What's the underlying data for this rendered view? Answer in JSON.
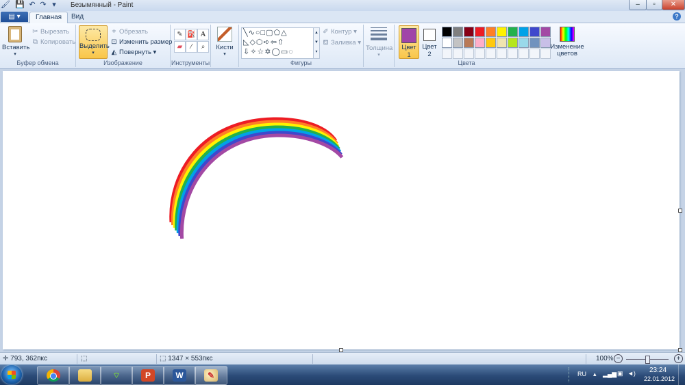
{
  "window": {
    "title": "Безымянный - Paint"
  },
  "tabs": [
    {
      "label": "Главная",
      "active": true
    },
    {
      "label": "Вид",
      "active": false
    }
  ],
  "ribbon": {
    "clipboard": {
      "group_label": "Буфер обмена",
      "paste": "Вставить",
      "cut": "Вырезать",
      "copy": "Копировать"
    },
    "image": {
      "group_label": "Изображение",
      "select": "Выделить",
      "crop": "Обрезать",
      "resize": "Изменить размер",
      "rotate": "Повернуть"
    },
    "tools": {
      "group_label": "Инструменты"
    },
    "brushes": {
      "label": "Кисти"
    },
    "shapes": {
      "group_label": "Фигуры",
      "outline": "Контур",
      "fill": "Заливка"
    },
    "size": {
      "label": "Толщина"
    },
    "colors": {
      "group_label": "Цвета",
      "color1": {
        "label": "Цвет",
        "num": "1",
        "value": "#a044a8"
      },
      "color2": {
        "label": "Цвет",
        "num": "2",
        "value": "#ffffff"
      },
      "edit": "Изменение цветов",
      "palette_row1": [
        "#000000",
        "#7f7f7f",
        "#880015",
        "#ed1c24",
        "#ff7f27",
        "#fff200",
        "#22b14c",
        "#00a2e8",
        "#3f48cc",
        "#a349a4"
      ],
      "palette_row2": [
        "#ffffff",
        "#c3c3c3",
        "#b97a57",
        "#ffaec9",
        "#ffc90e",
        "#efe4b0",
        "#b5e61d",
        "#99d9ea",
        "#7092be",
        "#c8bfe7"
      ]
    }
  },
  "canvas": {
    "rainbow_colors": [
      "#ed1c24",
      "#ff7f27",
      "#fff200",
      "#22b14c",
      "#00a2e8",
      "#3f48cc",
      "#a349a4"
    ]
  },
  "statusbar": {
    "cursor_pos": "793, 362пкс",
    "canvas_size": "1347 × 553пкс",
    "zoom": "100%"
  },
  "taskbar": {
    "apps": [
      "chrome",
      "explorer",
      "network",
      "powerpoint",
      "word",
      "paint"
    ],
    "lang": "RU",
    "time": "23:24",
    "date": "22.01.2012"
  }
}
